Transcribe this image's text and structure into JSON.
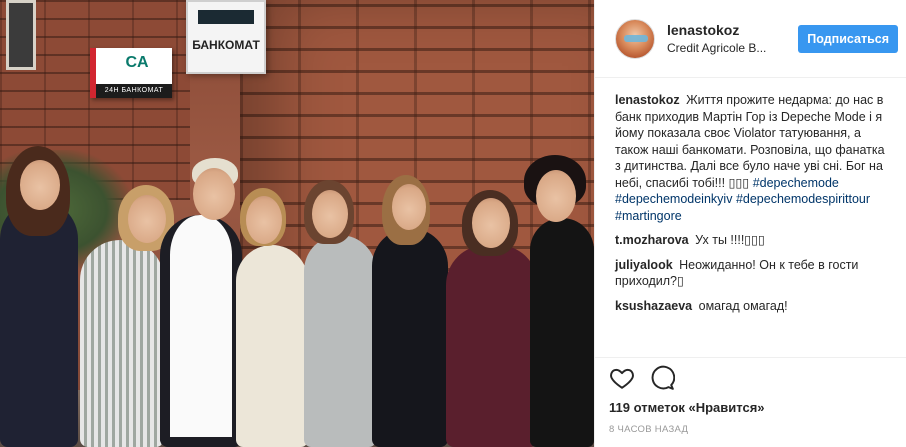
{
  "photo": {
    "atm_small_logo": "CA",
    "atm_small_label": "24H БАНКОМАТ",
    "atm_large_label": "БАНКОМАТ"
  },
  "header": {
    "username": "lenastokoz",
    "location": "Credit Agricole B...",
    "follow_label": "Подписаться"
  },
  "caption": {
    "username": "lenastokoz",
    "text": "Життя прожите недарма: до нас в банк приходив Мартін Гор із Depeche Mode і я йому показала своє Violator татуювання, а також наші банкомати. Розповіла, що фанатка з дитинства. Далі все було наче уві сні. Бог на небі, спасибі тобі!!! ▯▯▯",
    "hashtags": [
      "#depechemode",
      "#depechemodeinkyiv",
      "#depechemodespirittour",
      "#martingore"
    ]
  },
  "comments": [
    {
      "username": "t.mozharova",
      "text": "Ух ты !!!!▯▯▯"
    },
    {
      "username": "juliyalook",
      "text": "Неожиданно! Он к тебе в гости приходил?▯"
    },
    {
      "username": "ksushazaeva",
      "text": "омагад омагад!"
    }
  ],
  "actions": {
    "like_icon": "heart-icon",
    "comment_icon": "comment-bubble-icon"
  },
  "likes": "119 отметок «Нравится»",
  "timestamp": "8 ЧАСОВ НАЗАД",
  "colors": {
    "accent": "#3897f0",
    "hashtag": "#003569",
    "muted": "#999999"
  }
}
